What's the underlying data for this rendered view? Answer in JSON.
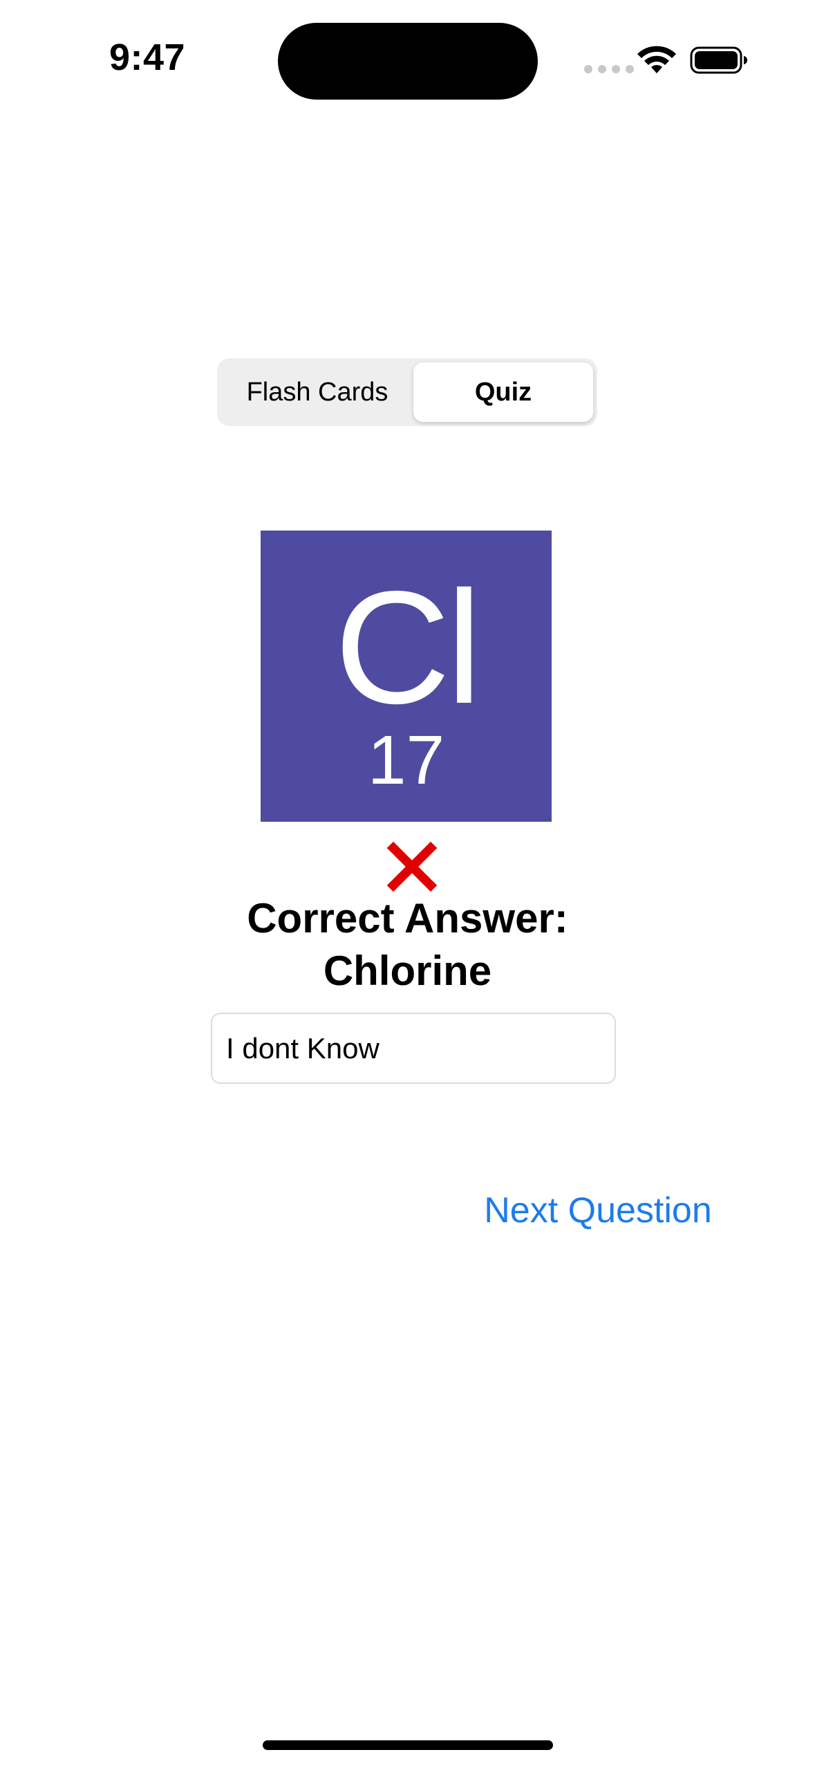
{
  "status_bar": {
    "time": "9:47",
    "icons": [
      "signal-dots-icon",
      "wifi-icon",
      "battery-icon"
    ]
  },
  "mode_selector": {
    "options": [
      "Flash Cards",
      "Quiz"
    ],
    "selected": "Quiz"
  },
  "element_card": {
    "symbol": "Cl",
    "atomic_number": "17",
    "color": "#4f4ba0"
  },
  "result": {
    "status_icon": "x-mark-icon",
    "status_color": "#e00000",
    "line1": "Correct Answer:",
    "line2": "Chlorine"
  },
  "answer_field": {
    "value": "I dont Know"
  },
  "actions": {
    "next_label": "Next Question",
    "accent_color": "#1e7bea"
  }
}
